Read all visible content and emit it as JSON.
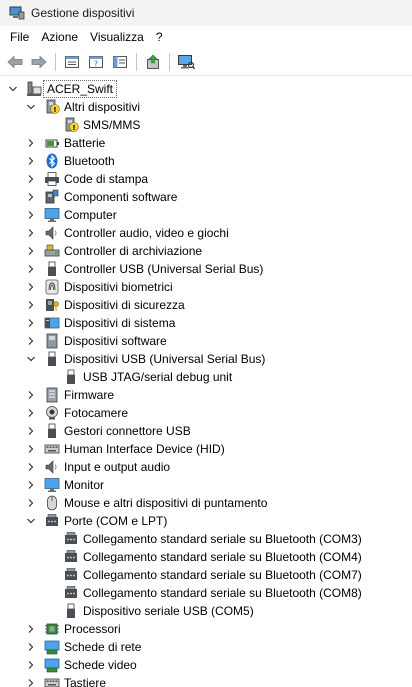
{
  "window": {
    "title": "Gestione dispositivi"
  },
  "menu": {
    "file": "File",
    "azione": "Azione",
    "visualizza": "Visualizza",
    "help": "?"
  },
  "toolbar": [
    "back-arrow-icon",
    "forward-arrow-icon",
    "properties-icon",
    "help-icon",
    "driver-icon",
    "update-driver-icon",
    "scan-hardware-icon",
    "monitor-icon"
  ],
  "tree": {
    "root": "ACER_Swift",
    "categories": [
      {
        "label": "Altri dispositivi",
        "icon": "unknown-device-icon",
        "expanded": true,
        "children": [
          "SMS/MMS"
        ]
      },
      {
        "label": "Batterie",
        "icon": "battery-icon",
        "expanded": false
      },
      {
        "label": "Bluetooth",
        "icon": "bluetooth-icon",
        "expanded": false
      },
      {
        "label": "Code di stampa",
        "icon": "printer-icon",
        "expanded": false
      },
      {
        "label": "Componenti software",
        "icon": "software-component-icon",
        "expanded": false
      },
      {
        "label": "Computer",
        "icon": "computer-icon",
        "expanded": false
      },
      {
        "label": "Controller audio, video e giochi",
        "icon": "speaker-icon",
        "expanded": false
      },
      {
        "label": "Controller di archiviazione",
        "icon": "storage-controller-icon",
        "expanded": false
      },
      {
        "label": "Controller USB (Universal Serial Bus)",
        "icon": "usb-icon",
        "expanded": false
      },
      {
        "label": "Dispositivi biometrici",
        "icon": "fingerprint-icon",
        "expanded": false
      },
      {
        "label": "Dispositivi di sicurezza",
        "icon": "security-key-icon",
        "expanded": false
      },
      {
        "label": "Dispositivi di sistema",
        "icon": "system-device-icon",
        "expanded": false
      },
      {
        "label": "Dispositivi software",
        "icon": "software-device-icon",
        "expanded": false
      },
      {
        "label": "Dispositivi USB (Universal Serial Bus)",
        "icon": "usb-icon",
        "expanded": true,
        "children": [
          "USB JTAG/serial debug unit"
        ]
      },
      {
        "label": "Firmware",
        "icon": "firmware-icon",
        "expanded": false
      },
      {
        "label": "Fotocamere",
        "icon": "camera-icon",
        "expanded": false
      },
      {
        "label": "Gestori connettore USB",
        "icon": "usb-icon",
        "expanded": false
      },
      {
        "label": "Human Interface Device (HID)",
        "icon": "keyboard-icon",
        "expanded": false
      },
      {
        "label": "Input e output audio",
        "icon": "speaker-icon",
        "expanded": false
      },
      {
        "label": "Monitor",
        "icon": "monitor-icon",
        "expanded": false
      },
      {
        "label": "Mouse e altri dispositivi di puntamento",
        "icon": "mouse-icon",
        "expanded": false
      },
      {
        "label": "Porte (COM e LPT)",
        "icon": "port-icon",
        "expanded": true,
        "children": [
          "Collegamento standard seriale su Bluetooth (COM3)",
          "Collegamento standard seriale su Bluetooth (COM4)",
          "Collegamento standard seriale su Bluetooth (COM7)",
          "Collegamento standard seriale su Bluetooth (COM8)",
          "Dispositivo seriale USB (COM5)"
        ]
      },
      {
        "label": "Processori",
        "icon": "processor-icon",
        "expanded": false
      },
      {
        "label": "Schede di rete",
        "icon": "network-adapter-icon",
        "expanded": false
      },
      {
        "label": "Schede video",
        "icon": "display-adapter-icon",
        "expanded": false
      },
      {
        "label": "Tastiere",
        "icon": "keyboard-icon",
        "expanded": false
      }
    ]
  }
}
